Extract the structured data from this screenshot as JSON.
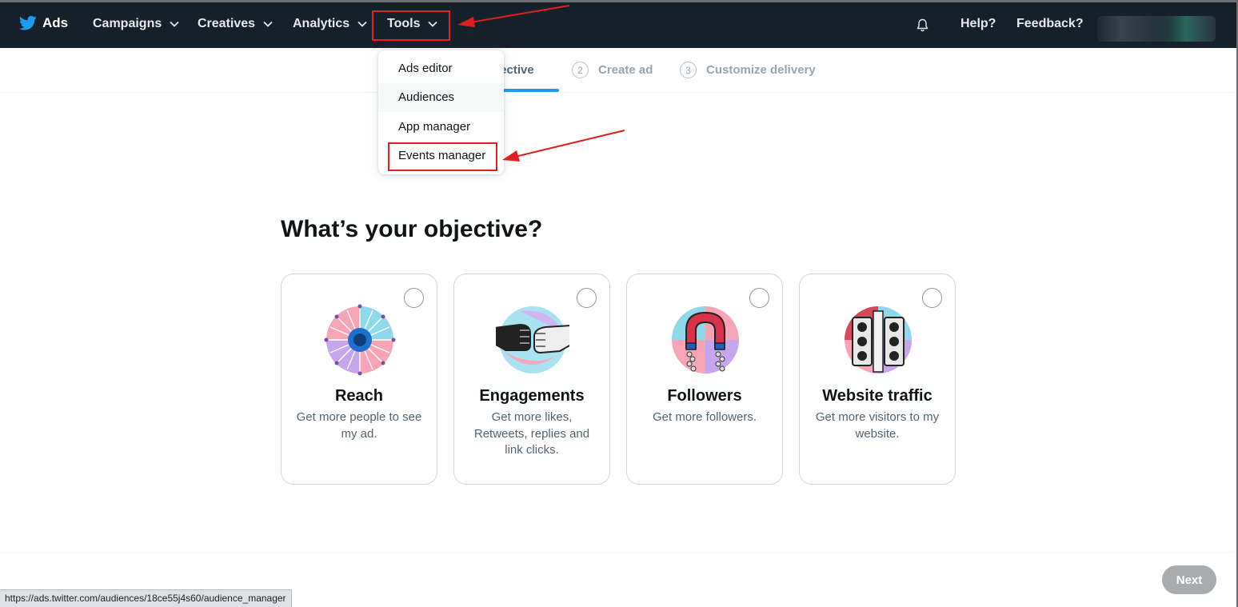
{
  "topbar": {
    "brand": "Ads",
    "nav": [
      {
        "label": "Campaigns"
      },
      {
        "label": "Creatives"
      },
      {
        "label": "Analytics"
      },
      {
        "label": "Tools"
      }
    ],
    "help": "Help?",
    "feedback": "Feedback?"
  },
  "steps": [
    {
      "label": "jective"
    },
    {
      "num": "2",
      "label": "Create ad"
    },
    {
      "num": "3",
      "label": "Customize delivery"
    }
  ],
  "tools_menu": {
    "items": [
      {
        "label": "Ads editor"
      },
      {
        "label": "Audiences"
      },
      {
        "label": "App manager"
      },
      {
        "label": "Events manager"
      }
    ]
  },
  "main": {
    "heading": "What’s your objective?",
    "cards": [
      {
        "title": "Reach",
        "desc": "Get more people to see my ad."
      },
      {
        "title": "Engagements",
        "desc": "Get more likes, Retweets, replies and link clicks."
      },
      {
        "title": "Followers",
        "desc": "Get more followers."
      },
      {
        "title": "Website traffic",
        "desc": "Get more visitors to my website."
      }
    ]
  },
  "footer": {
    "next": "Next"
  },
  "status_bar": {
    "url": "https://ads.twitter.com/audiences/18ce55j4s60/audience_manager"
  },
  "colors": {
    "nav_bg": "#15202b",
    "accent": "#1d9bf0",
    "highlight": "#e02020",
    "next_disabled": "#a8acaf"
  },
  "icons": [
    "twitter-bird-icon",
    "chevron-down-icon",
    "bell-icon"
  ]
}
